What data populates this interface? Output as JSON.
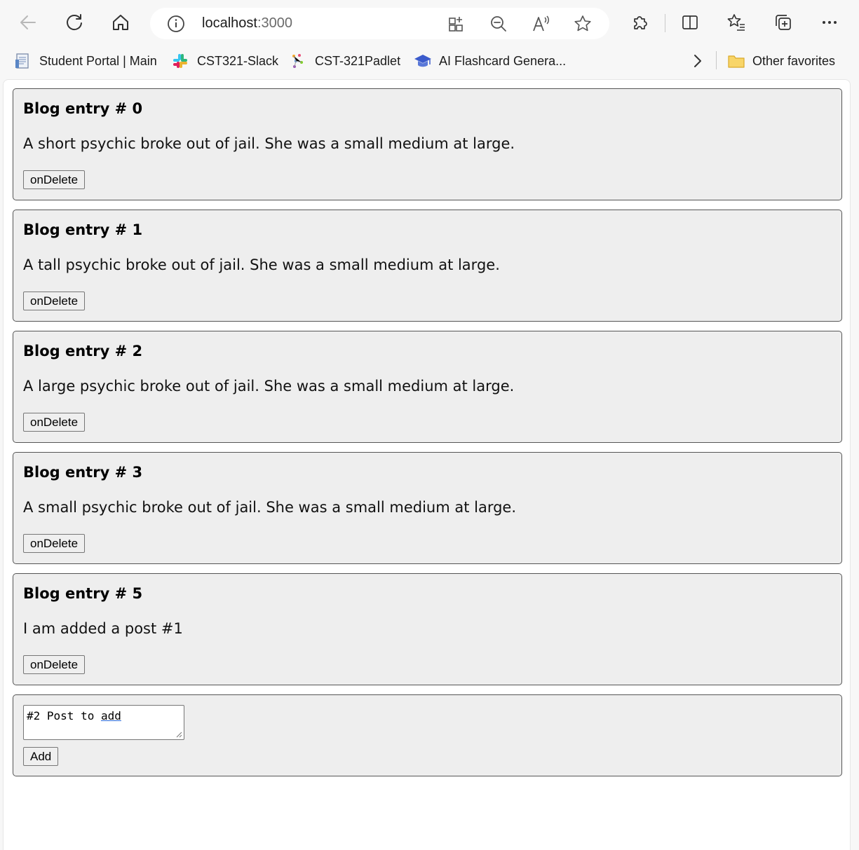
{
  "browser": {
    "address": {
      "host": "localhost",
      "port": ":3000"
    },
    "favorites": [
      {
        "label": "Student Portal | Main",
        "icon": "document-icon"
      },
      {
        "label": "CST321-Slack",
        "icon": "slack-icon"
      },
      {
        "label": "CST-321Padlet",
        "icon": "padlet-icon"
      },
      {
        "label": "AI Flashcard Genera...",
        "icon": "graduation-cap-icon"
      }
    ],
    "other_favorites": "Other favorites"
  },
  "posts": [
    {
      "title": "Blog entry # 0",
      "body": "A short psychic broke out of jail. She was a small medium at large.",
      "button": "onDelete"
    },
    {
      "title": "Blog entry # 1",
      "body": "A tall psychic broke out of jail. She was a small medium at large.",
      "button": "onDelete"
    },
    {
      "title": "Blog entry # 2",
      "body": "A large psychic broke out of jail. She was a small medium at large.",
      "button": "onDelete"
    },
    {
      "title": "Blog entry # 3",
      "body": "A small psychic broke out of jail. She was a small medium at large.",
      "button": "onDelete"
    },
    {
      "title": "Blog entry # 5",
      "body": "I am added a post #1",
      "button": "onDelete"
    }
  ],
  "composer": {
    "value_prefix": "#2 Post to ",
    "value_underlined": "add",
    "button": "Add"
  }
}
